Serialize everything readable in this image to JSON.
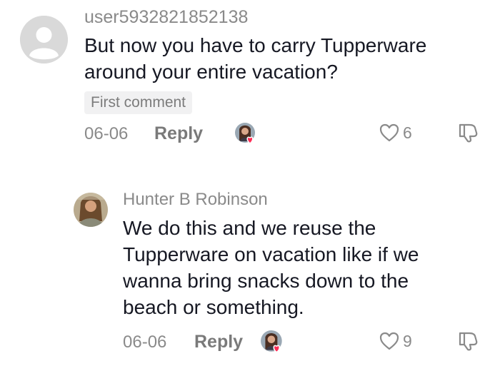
{
  "comments": [
    {
      "username": "user5932821852138",
      "text": "But now you have to carry Tupperware around your entire vacation?",
      "badge": "First comment",
      "date": "06-06",
      "reply_label": "Reply",
      "like_count": "6"
    },
    {
      "username": "Hunter B Robinson",
      "text": "We do this and we reuse the Tupperware on vacation like if we wanna bring snacks down to the beach or something.",
      "date": "06-06",
      "reply_label": "Reply",
      "like_count": "9"
    }
  ],
  "colors": {
    "heart_badge": "#fe2c55",
    "muted_text": "#8a8a8a",
    "body_text": "#161823"
  }
}
